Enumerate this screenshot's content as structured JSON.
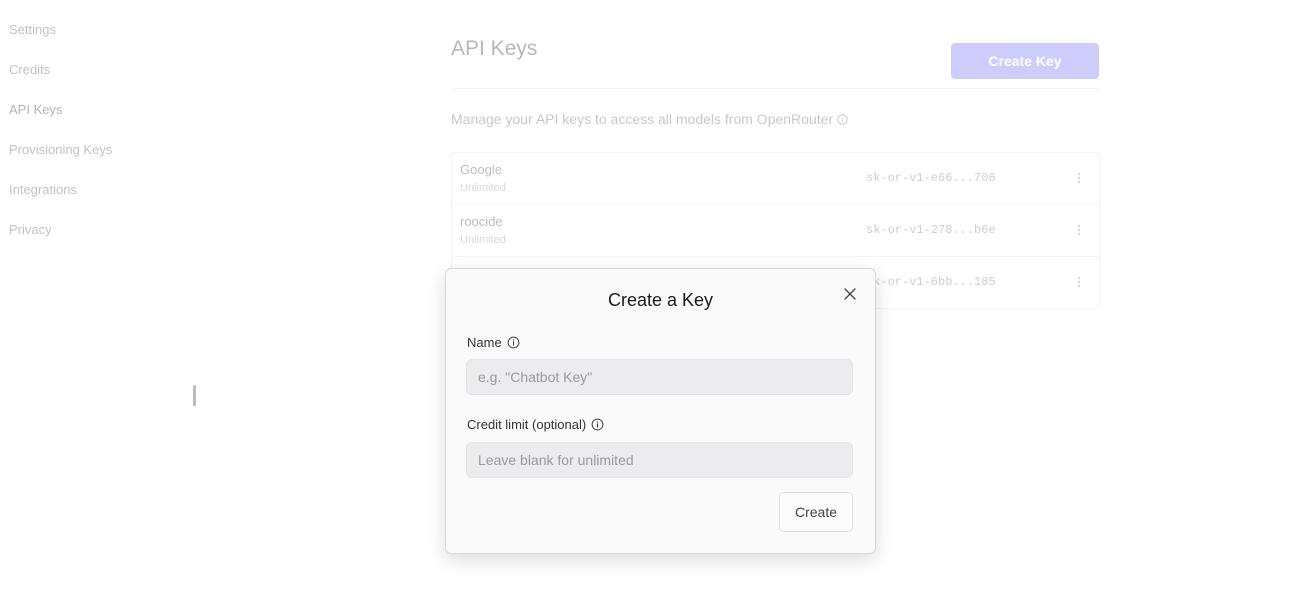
{
  "sidebar": {
    "items": [
      {
        "label": "Settings"
      },
      {
        "label": "Credits"
      },
      {
        "label": "API Keys"
      },
      {
        "label": "Provisioning Keys"
      },
      {
        "label": "Integrations"
      },
      {
        "label": "Privacy"
      }
    ],
    "active": "API Keys"
  },
  "header": {
    "title": "API Keys",
    "create_key_label": "Create Key",
    "description": "Manage your API keys to access all models from OpenRouter"
  },
  "keys": [
    {
      "name": "Google",
      "limit": "Unlimited",
      "key": "sk-or-v1-e66...706"
    },
    {
      "name": "roocide",
      "limit": "Unlimited",
      "key": "sk-or-v1-278...b6e"
    },
    {
      "name": "",
      "limit": "",
      "key": "sk-or-v1-6bb...185"
    }
  ],
  "modal": {
    "title": "Create a Key",
    "name_label": "Name",
    "name_placeholder": "e.g. \"Chatbot Key\"",
    "credit_label": "Credit limit (optional)",
    "credit_placeholder": "Leave blank for unlimited",
    "create_label": "Create"
  },
  "colors": {
    "accent": "#6466f1",
    "input_bg": "#ececee",
    "modal_bg": "#fafafa"
  },
  "icons": {
    "close": "close-icon",
    "info": "info-icon",
    "menu": "more-vertical-icon"
  }
}
